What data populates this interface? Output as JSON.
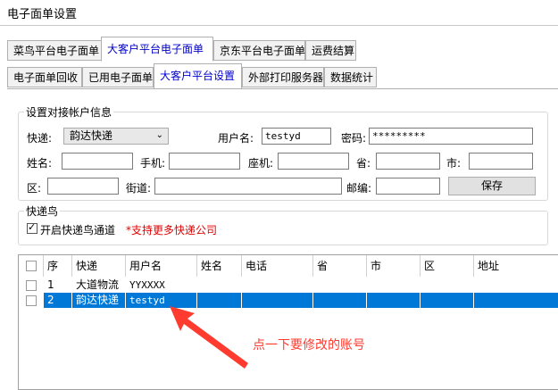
{
  "window": {
    "title": "电子面单设置"
  },
  "tabs_row1": [
    {
      "label": "菜鸟平台电子面单",
      "active": false
    },
    {
      "label": "大客户平台电子面单",
      "active": true
    },
    {
      "label": "京东平台电子面单",
      "active": false
    },
    {
      "label": "运费结算",
      "active": false
    }
  ],
  "tabs_row2": [
    {
      "label": "电子面单回收",
      "active": false
    },
    {
      "label": "已用电子面单",
      "active": false
    },
    {
      "label": "大客户平台设置",
      "active": true
    },
    {
      "label": "外部打印服务器",
      "active": false
    },
    {
      "label": "数据统计",
      "active": false
    }
  ],
  "account_group": {
    "legend": "设置对接帐户信息",
    "express_label": "快递:",
    "express_value": "韵达快递",
    "username_label": "用户名:",
    "username_value": "testyd",
    "password_label": "密码:",
    "password_value": "*********",
    "name_label": "姓名:",
    "mobile_label": "手机:",
    "phone_label": "座机:",
    "province_label": "省:",
    "city_label": "市:",
    "district_label": "区:",
    "street_label": "街道:",
    "postcode_label": "邮编:",
    "save_label": "保存"
  },
  "kdn_group": {
    "legend": "快递鸟",
    "enable_label": "开启快递鸟通道",
    "enable_checked": true,
    "support_note": "*支持更多快递公司"
  },
  "grid": {
    "columns": [
      "序",
      "快递",
      "用户名",
      "姓名",
      "电话",
      "省",
      "市",
      "区",
      "地址"
    ],
    "rows": [
      {
        "seq": "1",
        "express": "大道物流",
        "username": "YYXXXX",
        "selected": false
      },
      {
        "seq": "2",
        "express": "韵达快递",
        "username": "testyd",
        "selected": true
      }
    ]
  },
  "annotation": {
    "text": "点一下要修改的账号",
    "color": "#ff3b30"
  },
  "colors": {
    "selection": "#0078d7",
    "active_tab_text": "#0000cc",
    "note_red": "#e00000"
  }
}
